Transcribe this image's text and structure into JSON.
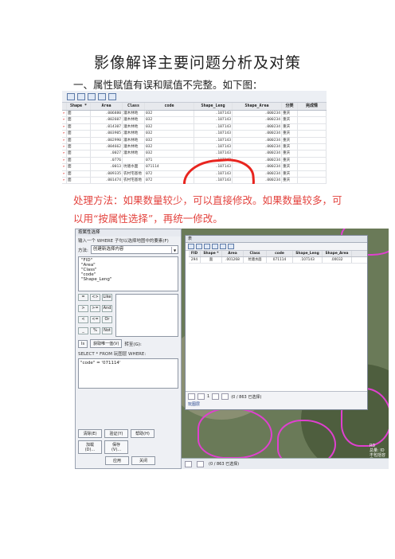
{
  "doc": {
    "title": "影像解译主要问题分析及对策",
    "section1": "一、属性赋值有误和赋值不完整。如下图：",
    "method": "处理方法：如果数量较少，可以直接修改。如果数量较多，可以用“按属性选择”，再统一修改。"
  },
  "table1": {
    "headers": [
      "Shape *",
      "Area",
      "Class",
      "code",
      "Shape_Leng",
      "Shape_Area",
      "分类",
      "完成情"
    ],
    "rows": [
      [
        "面",
        ".006880",
        "灌木林地",
        "032",
        ".107143",
        ".000234",
        "重庆",
        ""
      ],
      [
        "面",
        ".002607",
        "灌木林地",
        "032",
        ".107143",
        ".000234",
        "重庆",
        ""
      ],
      [
        "面",
        ".014307",
        "灌木林地",
        "032",
        ".107143",
        ".000234",
        "重庆",
        ""
      ],
      [
        "面",
        ".003905",
        "灌木林地",
        "032",
        ".107143",
        ".000234",
        "重庆",
        ""
      ],
      [
        "面",
        ".002990",
        "灌木林地",
        "032",
        ".107143",
        ".000234",
        "重庆",
        ""
      ],
      [
        "面",
        ".004662",
        "灌木林地",
        "032",
        ".107143",
        ".000234",
        "重庆",
        ""
      ],
      [
        "面",
        ".0027",
        "灌木林地",
        "032",
        ".107143",
        ".000234",
        "重庆",
        ""
      ],
      [
        "面",
        ".0776",
        "",
        "071",
        ".107143",
        ".000234",
        "重庆",
        ""
      ],
      [
        "面",
        ".0013",
        "坑塘水面",
        "071114",
        ".107143",
        ".000234",
        "重庆",
        ""
      ],
      [
        "面",
        ".009335",
        "农村宅基地",
        "072",
        ".107143",
        ".000234",
        "重庆",
        ""
      ],
      [
        "面",
        ".001474",
        "农村宅基地",
        "072",
        ".107143",
        ".000234",
        "重庆",
        ""
      ],
      [
        "面",
        ".000357",
        "农村宅基地",
        "072",
        ".107143",
        ".000234",
        "重庆",
        ""
      ],
      [
        "面",
        ".001101",
        "农村宅基地",
        "072",
        ".107143",
        ".000234",
        "重庆",
        ""
      ],
      [
        "面",
        ".000470",
        "农村宅基地",
        "072",
        ".107143",
        ".000234",
        "重庆",
        ""
      ],
      [
        "面",
        ".001722",
        "农村宅基地",
        "072",
        ".107143",
        ".000234",
        "重庆",
        ""
      ],
      [
        "面",
        ".000427",
        "农村宅基地",
        "072",
        ".107143",
        ".000234",
        "重庆",
        ""
      ],
      [
        "面",
        ".000368",
        "农村宅基地",
        "072",
        ".107143",
        ".000234",
        "重庆",
        ""
      ],
      [
        "面",
        ".000088",
        "农村宅基地",
        "072",
        ".107143",
        ".000234",
        "重庆",
        ""
      ],
      [
        "面",
        ".002221",
        "农村宅基地",
        "072",
        ".107143",
        ".000234",
        "重庆",
        ""
      ]
    ]
  },
  "dialog": {
    "title": "按属性选择",
    "layer_label": "输入一个 WHERE 子句以选择地图中的要素(F)",
    "method_label": "方法:",
    "method_value": "创建新选择内容",
    "fields": [
      "\"FID\"",
      "\"Area\"",
      "\"Class\"",
      "\"code\"",
      "\"Shape_Leng\""
    ],
    "ops": [
      "=",
      "<>",
      "Like",
      ">",
      ">=",
      "And",
      "<",
      "<=",
      "Or",
      "_",
      "%",
      "()",
      "Not"
    ],
    "is_label": "Is",
    "get_unique": "获取唯一值(V)",
    "goto_label": "转至(G):",
    "sql_prefix": "SELECT * FROM 玩图层 WHERE:",
    "sql_expr": "\"code\" = '071114'",
    "btn_clear": "清除(E)",
    "btn_verify": "验证(Y)",
    "btn_help": "帮助(H)",
    "btn_load": "加载(D)...",
    "btn_save": "保存(V)...",
    "btn_apply": "应用",
    "btn_close": "关闭"
  },
  "attr": {
    "title": "表",
    "headers": [
      "FID",
      "Shape *",
      "Area",
      "Class",
      "code",
      "Shape_Leng",
      "Shape_Area"
    ],
    "row": [
      "294",
      "面",
      ".001268",
      "坑塘水面",
      "071114",
      ".107143",
      ".00032"
    ],
    "nav_page": "1",
    "count": "(0 / 863 已选择)",
    "layer_label": "玩图层",
    "bottom_label": "(0 / 863 已选择)",
    "info_lines": [
      "RD",
      "总量: ID",
      "不包括容量"
    ]
  }
}
